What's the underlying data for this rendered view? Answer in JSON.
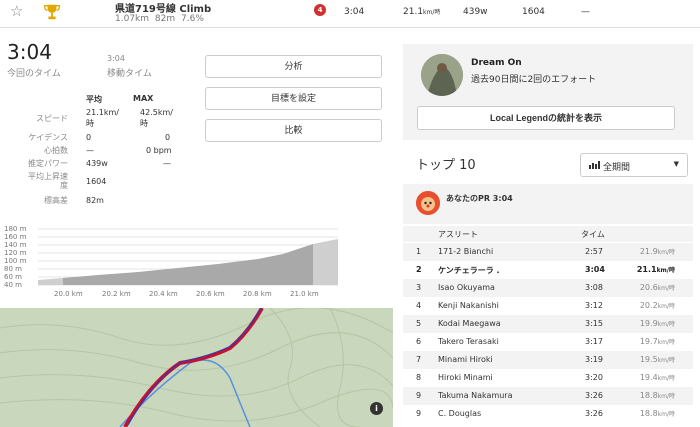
{
  "segment": {
    "name": "県道719号線 Climb",
    "distance": "1.07km",
    "elev_gain": "82m",
    "grade": "7.6%"
  },
  "summary_row": {
    "badge": "4",
    "time": "3:04",
    "speed": "21.1",
    "speed_unit": "km/時",
    "power": "439w",
    "count": "1604",
    "dash": "—"
  },
  "effort": {
    "time": "3:04",
    "time_label": "今回のタイム",
    "moving_time": "3:04",
    "moving_label": "移動タイム"
  },
  "actions": [
    "分析",
    "目標を設定",
    "比較"
  ],
  "stats": {
    "col_avg": "平均",
    "col_max": "MAX",
    "rows": [
      {
        "label": "スピード",
        "avg": "21.1km/",
        "avg2": "時",
        "max": "42.5km/",
        "max2": "時"
      },
      {
        "label": "ケイデンス",
        "avg": "0",
        "max": "0"
      },
      {
        "label": "心拍数",
        "avg": "—",
        "max": "0 bpm"
      },
      {
        "label": "推定パワー",
        "avg": "439w",
        "max": "—"
      },
      {
        "label": "平均上昇速度",
        "avg": "1604",
        "max": ""
      },
      {
        "label": "標高差",
        "avg": "82m",
        "max": ""
      }
    ]
  },
  "elevation": {
    "y_ticks": [
      "180 m",
      "160 m",
      "140 m",
      "120 m",
      "100 m",
      "80 m",
      "60 m",
      "40 m"
    ],
    "x_ticks": [
      "20.0 km",
      "20.2 km",
      "20.4 km",
      "20.6 km",
      "20.8 km",
      "21.0 km"
    ]
  },
  "map": {
    "info": "i"
  },
  "local_legend": {
    "title": "Dream On",
    "subtitle": "過去90日間に2回のエフォート",
    "button": "Local Legendの統計を表示"
  },
  "leaderboard": {
    "title": "トップ 10",
    "period": "全期間",
    "pr_text": "あなたのPR 3:04",
    "col_athlete": "アスリート",
    "col_time": "タイム",
    "rows": [
      {
        "rank": "1",
        "name": "171-2 Bianchi",
        "time": "2:57",
        "speed": "21.9",
        "unit": "km/時"
      },
      {
        "rank": "2",
        "name": "ケンチェラーラ .",
        "time": "3:04",
        "speed": "21.1",
        "unit": "km/時"
      },
      {
        "rank": "3",
        "name": "Isao Okuyama",
        "time": "3:08",
        "speed": "20.6",
        "unit": "km/時"
      },
      {
        "rank": "4",
        "name": "Kenji Nakanishi",
        "time": "3:12",
        "speed": "20.2",
        "unit": "km/時"
      },
      {
        "rank": "5",
        "name": "Kodai Maegawa",
        "time": "3:15",
        "speed": "19.9",
        "unit": "km/時"
      },
      {
        "rank": "6",
        "name": "Takero Terasaki",
        "time": "3:17",
        "speed": "19.7",
        "unit": "km/時"
      },
      {
        "rank": "7",
        "name": "Minami Hiroki",
        "time": "3:19",
        "speed": "19.5",
        "unit": "km/時"
      },
      {
        "rank": "8",
        "name": "Hiroki Minami",
        "time": "3:20",
        "speed": "19.4",
        "unit": "km/時"
      },
      {
        "rank": "9",
        "name": "Takuma Nakamura",
        "time": "3:26",
        "speed": "18.8",
        "unit": "km/時"
      },
      {
        "rank": "9",
        "name": "C. Douglas",
        "time": "3:26",
        "speed": "18.8",
        "unit": "km/時"
      }
    ]
  },
  "colors": {
    "accent": "#fc4c02",
    "route": "#c8102e",
    "water": "#3b6fd8",
    "map": "#c9d8bd"
  }
}
